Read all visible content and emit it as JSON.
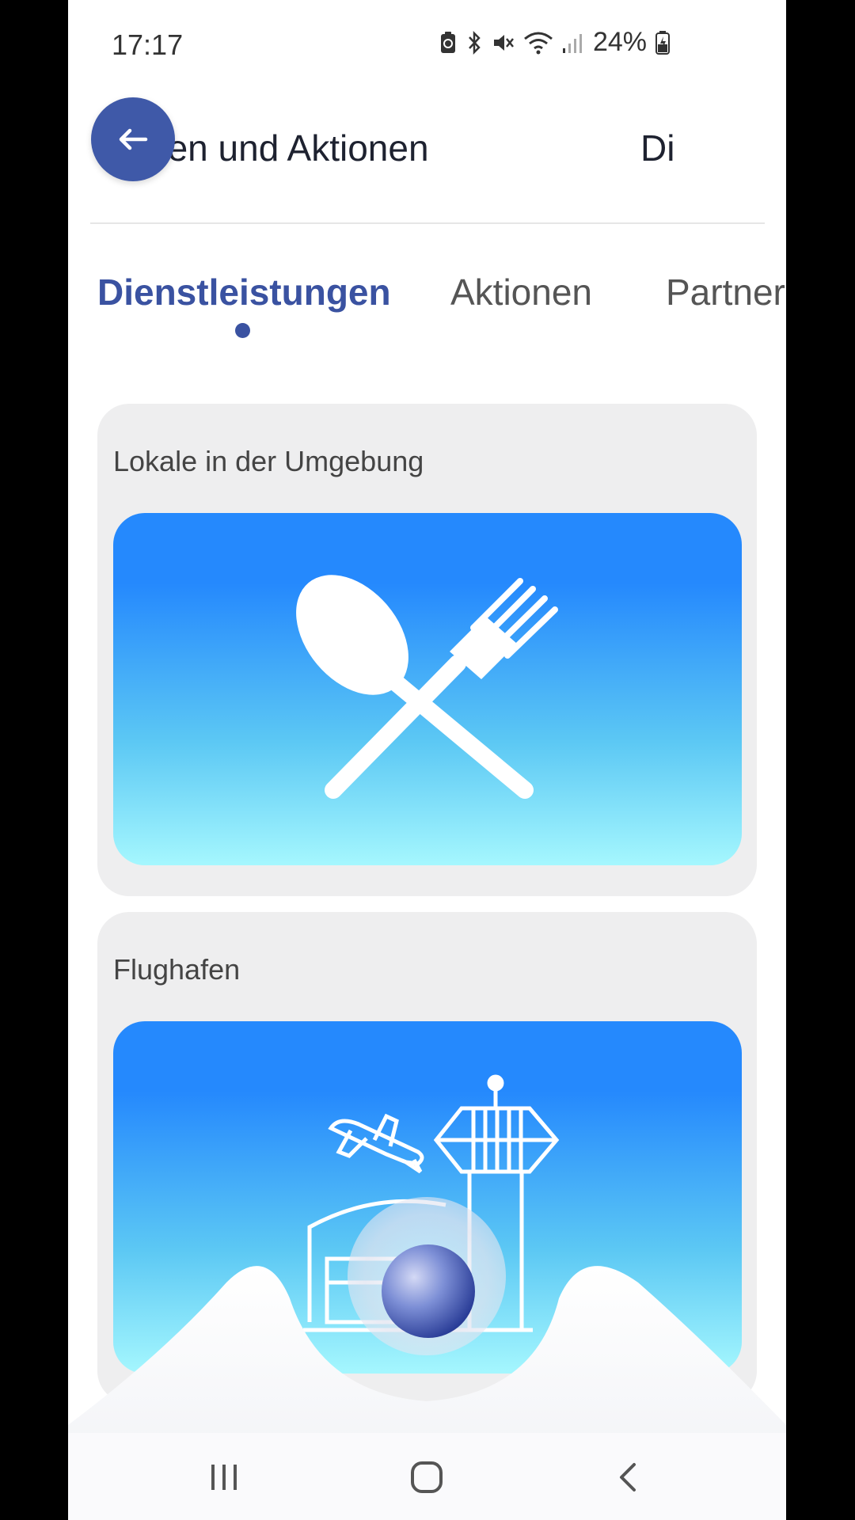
{
  "status_bar": {
    "time": "17:17",
    "battery_percent": "24%",
    "icons": [
      "battery-saver-icon",
      "bluetooth-icon",
      "mute-icon",
      "wifi-icon",
      "signal-icon",
      "battery-charging-icon"
    ]
  },
  "header": {
    "back_icon": "arrow-left-icon",
    "title": "gen und Aktionen",
    "next_title": "Di"
  },
  "tabs": [
    {
      "label": "Dienstleistungen",
      "active": true
    },
    {
      "label": "Aktionen",
      "active": false
    },
    {
      "label": "Partner",
      "active": false
    }
  ],
  "cards": [
    {
      "label": "Lokale in der Umgebung",
      "icon": "cutlery-icon"
    },
    {
      "label": "Flughafen",
      "icon": "airport-icon"
    }
  ],
  "assistant": {
    "icon": "assistant-orb-icon"
  },
  "nav_bar": {
    "icons": [
      "recent-apps-icon",
      "home-icon",
      "back-icon"
    ]
  },
  "colors": {
    "accent": "#3a52a1",
    "banner_top": "#2589fd",
    "banner_bottom": "#a5f7fe",
    "card_bg": "#eeeeef"
  }
}
